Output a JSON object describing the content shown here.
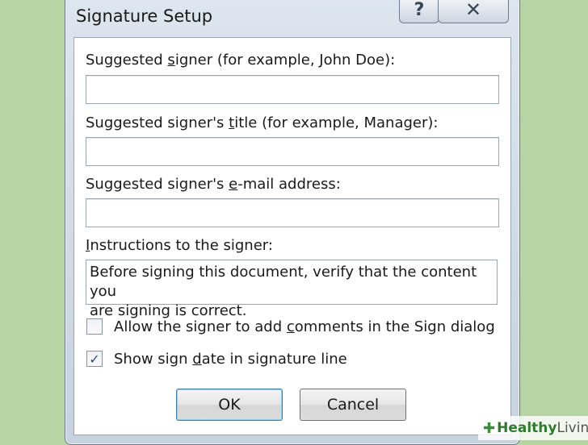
{
  "dialog": {
    "title": "Signature Setup",
    "help_label": "?",
    "close_label": "✕"
  },
  "fields": {
    "signer_label_pre": "Suggested ",
    "signer_label_key": "s",
    "signer_label_post": "igner (for example, John Doe):",
    "signer_value": "",
    "title_label_pre": "Suggested signer's ",
    "title_label_key": "t",
    "title_label_post": "itle (for example, Manager):",
    "title_value": "",
    "email_label_pre": "Suggested signer's ",
    "email_label_key": "e",
    "email_label_post": "-mail address:",
    "email_value": "",
    "instructions_label_key": "I",
    "instructions_label_post": "nstructions to the signer:",
    "instructions_value": "Before signing this document, verify that the content you\nare signing is correct."
  },
  "options": {
    "allow_comments_pre": "Allow the signer to add ",
    "allow_comments_key": "c",
    "allow_comments_post": "omments in the Sign dialog",
    "allow_comments_checked": false,
    "show_date_pre": "Show sign ",
    "show_date_key": "d",
    "show_date_post": "ate in signature line",
    "show_date_checked": true,
    "check_mark": "✓"
  },
  "buttons": {
    "ok_label": "OK",
    "cancel_label": "Cancel"
  },
  "watermark": {
    "icon": "✚",
    "text_a": "Healthy",
    "text_b": " Living"
  }
}
